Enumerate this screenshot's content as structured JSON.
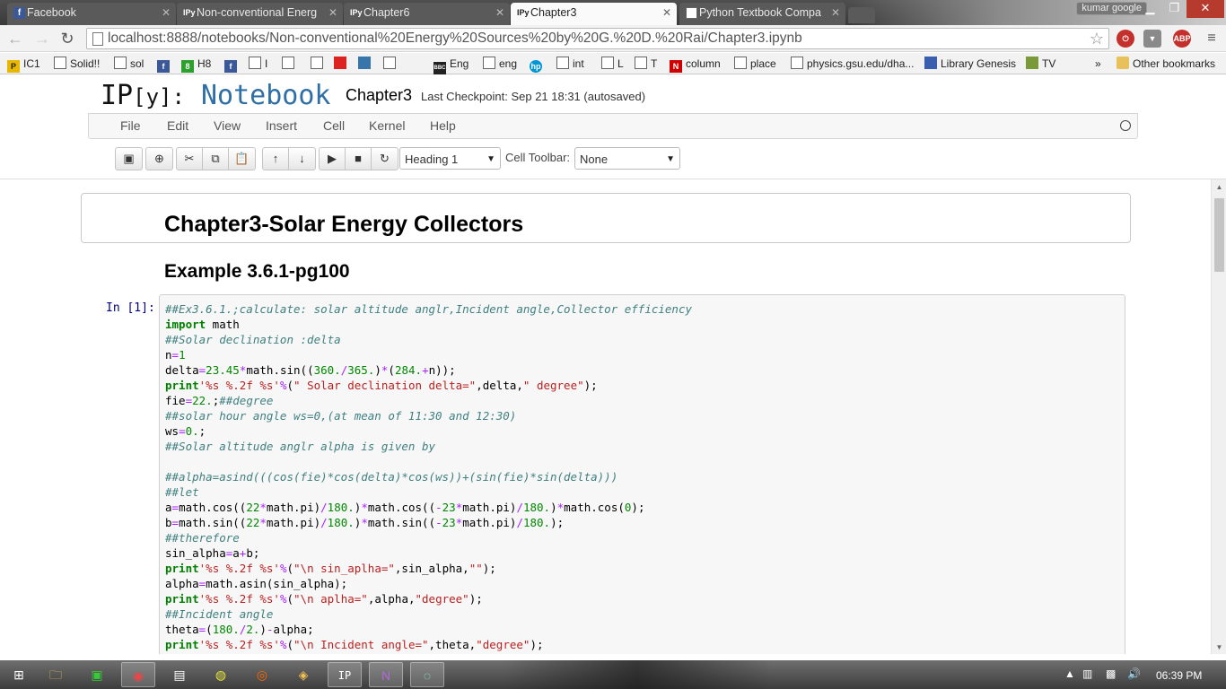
{
  "browser": {
    "tabs": [
      {
        "title": "Facebook",
        "icon": "facebook-icon",
        "active": false
      },
      {
        "title": "Non-conventional Energ",
        "icon": "ipython-icon",
        "active": false
      },
      {
        "title": "Chapter6",
        "icon": "ipython-icon",
        "active": false
      },
      {
        "title": "Chapter3",
        "icon": "ipython-icon",
        "active": true
      },
      {
        "title": "Python Textbook Compa",
        "icon": "page-icon",
        "active": false
      }
    ],
    "profile": "kumar google",
    "url": "localhost:8888/notebooks/Non-conventional%20Energy%20Sources%20by%20G.%20D.%20Rai/Chapter3.ipynb",
    "extensions": [
      "ABP"
    ],
    "bookmarks": [
      {
        "label": "IC1",
        "icon": "bookmark-page-icon"
      },
      {
        "label": "Solid!!",
        "icon": "bookmark-page-icon"
      },
      {
        "label": "sol",
        "icon": "bookmark-page-icon"
      },
      {
        "label": "H8",
        "icon": "bookmark-facebook-icon"
      },
      {
        "label": "I",
        "icon": "bookmark-page-icon"
      },
      {
        "label": "Eng",
        "icon": "bookmark-bbc-icon"
      },
      {
        "label": "eng",
        "icon": "bookmark-page-icon"
      },
      {
        "label": "int",
        "icon": "bookmark-page-icon"
      },
      {
        "label": "L",
        "icon": "bookmark-page-icon"
      },
      {
        "label": "T",
        "icon": "bookmark-page-icon"
      },
      {
        "label": "column",
        "icon": "bookmark-n-icon"
      },
      {
        "label": "place",
        "icon": "bookmark-page-icon"
      },
      {
        "label": "physics.gsu.edu/dha...",
        "icon": "bookmark-page-icon"
      },
      {
        "label": "Library Genesis",
        "icon": "bookmark-page-icon"
      },
      {
        "label": "TV",
        "icon": "bookmark-page-icon"
      }
    ],
    "overflow": "»",
    "other_bookmarks": "Other bookmarks"
  },
  "notebook": {
    "logo_ip": "IP",
    "logo_y": "[y]:",
    "logo_word": "Notebook",
    "name": "Chapter3",
    "checkpoint": "Last Checkpoint: Sep 21 18:31 (autosaved)",
    "menus": [
      "File",
      "Edit",
      "View",
      "Insert",
      "Cell",
      "Kernel",
      "Help"
    ],
    "cell_type": "Heading 1",
    "cell_toolbar_label": "Cell Toolbar:",
    "cell_toolbar_value": "None",
    "heading1": "Chapter3-Solar Energy Collectors",
    "heading2": "Example 3.6.1-pg100",
    "prompt": "In [1]:"
  },
  "taskbar": {
    "clock": "06:39 PM"
  },
  "colors": {
    "accent": "#2f6fa5",
    "code_bg": "#f7f7f7",
    "comment": "#408080",
    "keyword": "#008000",
    "string": "#ba2121",
    "prompt": "#000080"
  }
}
